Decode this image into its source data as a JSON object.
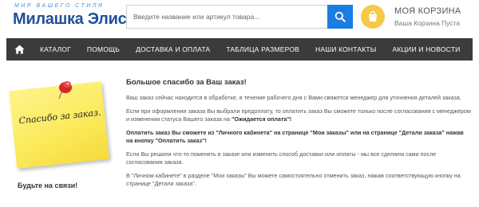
{
  "header": {
    "logo_sub": "МИР ВАШЕГО СТИЛЯ",
    "logo_main": "Милашка Элис",
    "search_placeholder": "Введите название или артикул товара...",
    "cart_title": "МОЯ КОРЗИНА",
    "cart_subtitle": "Ваша Корзина Пуста"
  },
  "nav": {
    "items": [
      "КАТАЛОГ",
      "ПОМОЩЬ",
      "ДОСТАВКА И ОПЛАТА",
      "ТАБЛИЦА РАЗМЕРОВ",
      "НАШИ КОНТАКТЫ",
      "АКЦИИ И НОВОСТИ"
    ]
  },
  "note": {
    "text": "Спасибо за заказ."
  },
  "footer_text": "Будьте на связи!",
  "content": {
    "title": "Большое спасибо за Ваш заказ!",
    "p1": "Ваш заказ сейчас находится в обработке, в течение рабочего дня с Вами свяжется менеджер для уточнения деталей заказа.",
    "p2_before": "Если при оформлении заказа Вы выбрали предоплату, то оплатить заказ Вы сможете только после согласования с менеджером и изменения статуса Вашего заказа на ",
    "p2_bold": "\"Ожидается оплата\"!",
    "p3": "Оплатить заказ Вы сможете из \"Личного кабинета\" на странице \"Мои заказы\" или на странице \"Детали заказа\" нажав на кнопку \"Оплатить заказ\"!",
    "p4": "Если Вы решили что-то поменять в заказе или изменить способ доставки или оплаты - мы все сделаем сами после согласования заказа.",
    "p5": "В \"Личном кабинете\" в разделе \"Мои заказы\" Вы можете самостоятельно отменить заказ, нажав соответствующую кнопку на странице \"Детали заказа\"."
  },
  "colors": {
    "logo": "#1f4f9a",
    "search_button": "#1a7de0",
    "cart_icon": "#f7c948",
    "nav_bg": "#3b3b3b",
    "note": "#fbe95a"
  }
}
